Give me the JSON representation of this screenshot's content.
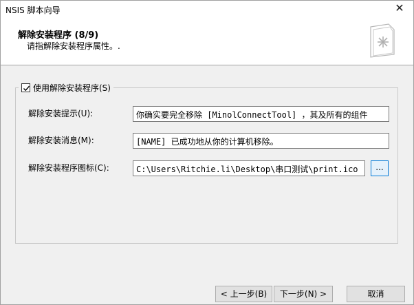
{
  "window": {
    "title": "NSIS 脚本向导",
    "close_glyph": "✕"
  },
  "header": {
    "title": "解除安装程序 (8/9)",
    "subtitle": "请指解除安装程序属性。.",
    "icon": "wizard-document-icon"
  },
  "group": {
    "checkbox_label": "使用解除安装程序(S)",
    "checkbox_checked": true,
    "fields": [
      {
        "label": "解除安装提示(U):",
        "value": "你确实要完全移除 [MinolConnectTool] ，其及所有的组件"
      },
      {
        "label": "解除安装消息(M):",
        "value": "[NAME] 已成功地从你的计算机移除。"
      },
      {
        "label": "解除安装程序图标(C):",
        "value": "C:\\Users\\Ritchie.li\\Desktop\\串口测试\\print.ico"
      }
    ],
    "browse_label": "..."
  },
  "buttons": {
    "back": "< 上一步(B)",
    "next": "下一步(N) >",
    "cancel": "取消"
  }
}
